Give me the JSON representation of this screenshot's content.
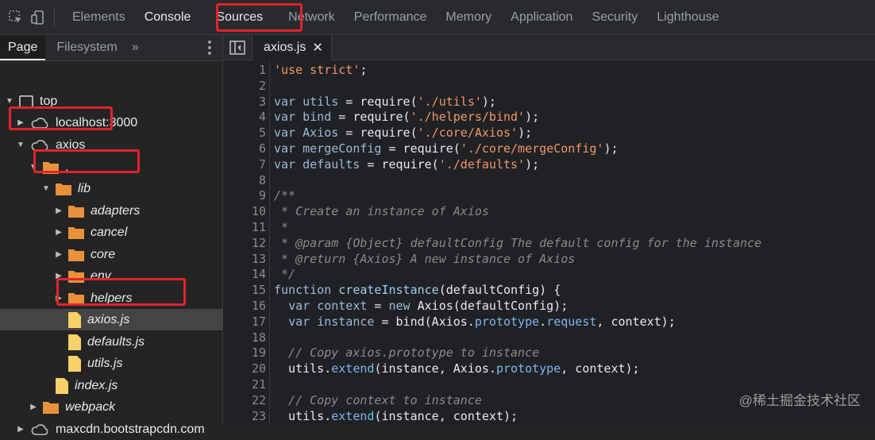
{
  "toolbar": {
    "tabs": [
      {
        "label": "Elements"
      },
      {
        "label": "Console"
      },
      {
        "label": "Sources"
      },
      {
        "label": "Network"
      },
      {
        "label": "Performance"
      },
      {
        "label": "Memory"
      },
      {
        "label": "Application"
      },
      {
        "label": "Security"
      },
      {
        "label": "Lighthouse"
      }
    ],
    "selected_tab": "Sources"
  },
  "navigator": {
    "tabs": [
      {
        "label": "Page"
      },
      {
        "label": "Filesystem"
      }
    ],
    "more_label": "»",
    "tree": [
      {
        "label": "top",
        "icon": "frame-icon",
        "expanded": true
      },
      {
        "label": "localhost:3000",
        "icon": "cloud-icon",
        "expanded": false
      },
      {
        "label": "axios",
        "icon": "cloud-icon",
        "expanded": true
      },
      {
        "label": ".",
        "icon": "folder-icon",
        "expanded": true
      },
      {
        "label": "lib",
        "icon": "folder-icon",
        "expanded": true
      },
      {
        "label": "adapters",
        "icon": "folder-icon",
        "expanded": false
      },
      {
        "label": "cancel",
        "icon": "folder-icon",
        "expanded": false
      },
      {
        "label": "core",
        "icon": "folder-icon",
        "expanded": false
      },
      {
        "label": "env",
        "icon": "folder-icon",
        "expanded": false
      },
      {
        "label": "helpers",
        "icon": "folder-icon",
        "expanded": false
      },
      {
        "label": "axios.js",
        "icon": "file-icon",
        "selected": true
      },
      {
        "label": "defaults.js",
        "icon": "file-icon"
      },
      {
        "label": "utils.js",
        "icon": "file-icon"
      },
      {
        "label": "index.js",
        "icon": "file-icon"
      },
      {
        "label": "webpack",
        "icon": "folder-icon",
        "expanded": false
      },
      {
        "label": "maxcdn.bootstrapcdn.com",
        "icon": "cloud-icon",
        "expanded": false
      }
    ]
  },
  "editor": {
    "open_file": "axios.js",
    "close_label": "✕",
    "lines": [
      {
        "n": "1",
        "t": "'use strict';"
      },
      {
        "n": "2",
        "t": ""
      },
      {
        "n": "3",
        "t": "var utils = require('./utils');"
      },
      {
        "n": "4",
        "t": "var bind = require('./helpers/bind');"
      },
      {
        "n": "5",
        "t": "var Axios = require('./core/Axios');"
      },
      {
        "n": "6",
        "t": "var mergeConfig = require('./core/mergeConfig');"
      },
      {
        "n": "7",
        "t": "var defaults = require('./defaults');"
      },
      {
        "n": "8",
        "t": ""
      },
      {
        "n": "9",
        "t": "/**"
      },
      {
        "n": "10",
        "t": " * Create an instance of Axios"
      },
      {
        "n": "11",
        "t": " *"
      },
      {
        "n": "12",
        "t": " * @param {Object} defaultConfig The default config for the instance"
      },
      {
        "n": "13",
        "t": " * @return {Axios} A new instance of Axios"
      },
      {
        "n": "14",
        "t": " */"
      },
      {
        "n": "15",
        "t": "function createInstance(defaultConfig) {"
      },
      {
        "n": "16",
        "t": "  var context = new Axios(defaultConfig);"
      },
      {
        "n": "17",
        "t": "  var instance = bind(Axios.prototype.request, context);"
      },
      {
        "n": "18",
        "t": ""
      },
      {
        "n": "19",
        "t": "  // Copy axios.prototype to instance"
      },
      {
        "n": "20",
        "t": "  utils.extend(instance, Axios.prototype, context);"
      },
      {
        "n": "21",
        "t": ""
      },
      {
        "n": "22",
        "t": "  // Copy context to instance"
      },
      {
        "n": "23",
        "t": "  utils.extend(instance, context);"
      }
    ]
  },
  "watermark": "@稀土掘金技术社区",
  "colors": {
    "highlight": "#e0242b",
    "folder": "#e8913a",
    "file": "#f5d167",
    "string": "#f29766",
    "keyword": "#9bbbdc"
  }
}
